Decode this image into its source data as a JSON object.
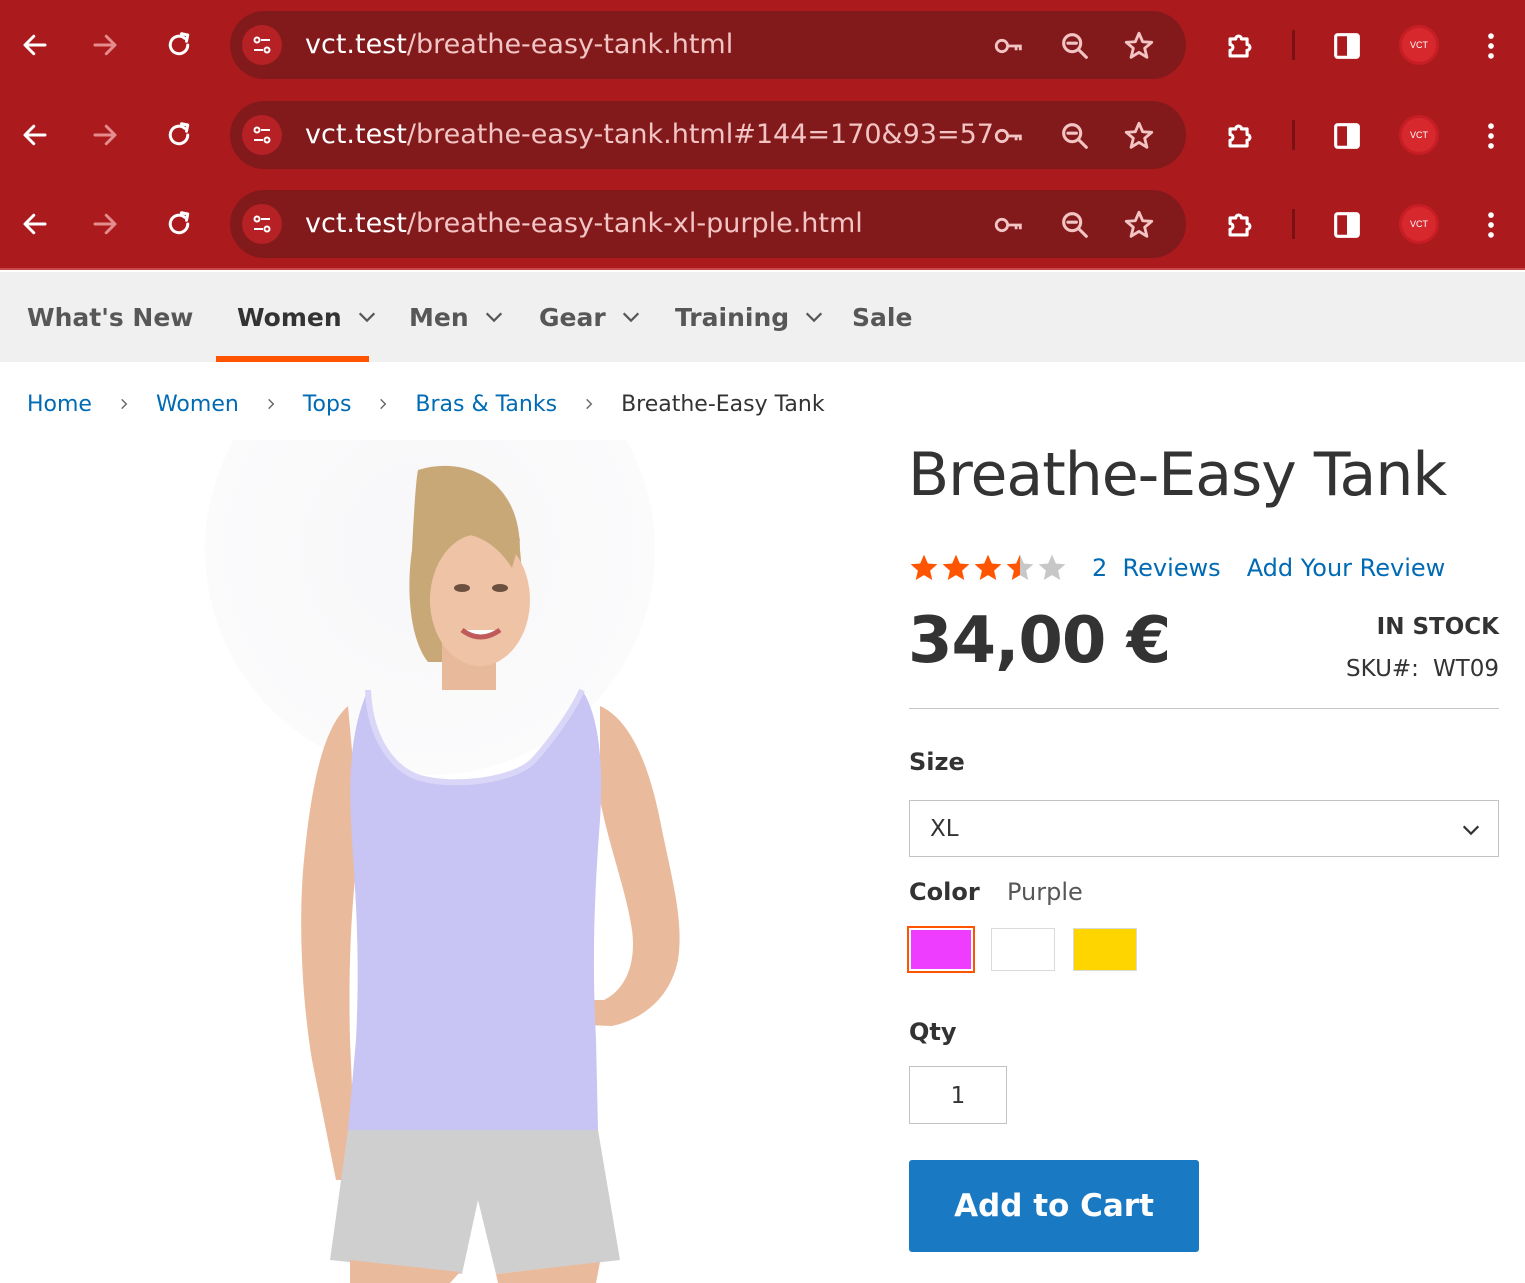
{
  "browser": {
    "rows": [
      {
        "url_host": "vct.test",
        "url_path": "/breathe-easy-tank.html"
      },
      {
        "url_host": "vct.test",
        "url_path": "/breathe-easy-tank.html#144=170&93=57"
      },
      {
        "url_host": "vct.test",
        "url_path": "/breathe-easy-tank-xl-purple.html"
      }
    ],
    "profile_label": "VCT",
    "icons": [
      "back-arrow-icon",
      "forward-arrow-icon",
      "reload-icon",
      "site-settings-icon",
      "password-key-icon",
      "zoom-icon",
      "bookmark-star-icon",
      "extensions-puzzle-icon",
      "side-panel-icon",
      "menu-kebab-icon"
    ],
    "colors": {
      "toolbar": "#ab1b1e",
      "omnibox": "#82191b"
    }
  },
  "nav": {
    "items": [
      {
        "label": "What's New",
        "has_dropdown": false
      },
      {
        "label": "Women",
        "has_dropdown": true,
        "active": true
      },
      {
        "label": "Men",
        "has_dropdown": true
      },
      {
        "label": "Gear",
        "has_dropdown": true
      },
      {
        "label": "Training",
        "has_dropdown": true
      },
      {
        "label": "Sale",
        "has_dropdown": false
      }
    ],
    "active_color": "#ff5501"
  },
  "breadcrumbs": {
    "links": [
      "Home",
      "Women",
      "Tops",
      "Bras & Tanks"
    ],
    "current": "Breathe-Easy Tank"
  },
  "product": {
    "title": "Breathe-Easy Tank",
    "rating": 3.5,
    "rating_max": 5,
    "reviews_count": "2",
    "reviews_label": "Reviews",
    "add_review_label": "Add Your Review",
    "price": "34,00 €",
    "stock": "IN STOCK",
    "sku_label": "SKU#:",
    "sku": "WT09",
    "size": {
      "label": "Size",
      "selected": "XL"
    },
    "color": {
      "label": "Color",
      "selected": "Purple",
      "swatches": [
        {
          "name": "Purple",
          "hex": "#ef3dff",
          "selected": true
        },
        {
          "name": "White",
          "hex": "#ffffff",
          "selected": false
        },
        {
          "name": "Yellow",
          "hex": "#ffd500",
          "selected": false
        }
      ]
    },
    "qty": {
      "label": "Qty",
      "value": "1"
    },
    "add_to_cart_label": "Add to Cart",
    "colors": {
      "link": "#006bb4",
      "button": "#1979c3",
      "star_on": "#ff5501",
      "star_off": "#c7c7c7"
    }
  }
}
